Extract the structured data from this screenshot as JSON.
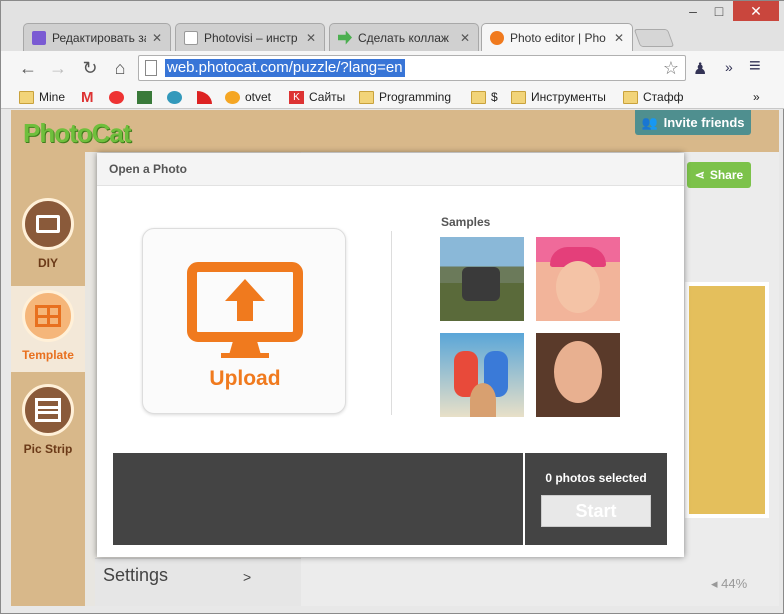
{
  "tabs": [
    {
      "title": "Редактировать за",
      "close": "✕"
    },
    {
      "title": "Photovisi – инстр",
      "close": "✕"
    },
    {
      "title": "Сделать коллаж",
      "close": "✕"
    },
    {
      "title": "Photo editor | Pho",
      "close": "✕"
    }
  ],
  "window": {
    "minimize": "–",
    "maximize": "□",
    "close": "✕"
  },
  "nav": {
    "back": "←",
    "forward": "→",
    "reload": "↻",
    "home": "⌂",
    "url": "web.photocat.com/puzzle/?lang=en",
    "star": "☆",
    "menu": "≡",
    "more": "»"
  },
  "bookmarks": [
    {
      "label": "Mine",
      "icon": "folder-icon"
    },
    {
      "label": "",
      "icon": "gmail-icon"
    },
    {
      "label": "",
      "icon": "bug-icon"
    },
    {
      "label": "",
      "icon": "app-icon"
    },
    {
      "label": "",
      "icon": "globe-icon"
    },
    {
      "label": "",
      "icon": "feed-icon"
    },
    {
      "label": "otvet",
      "icon": "otvet-icon"
    },
    {
      "label": "Сайты",
      "icon": "k-icon"
    },
    {
      "label": "Programming",
      "icon": "folder-icon"
    },
    {
      "label": "$",
      "icon": "folder-icon"
    },
    {
      "label": "Инструменты",
      "icon": "folder-icon"
    },
    {
      "label": "Стафф",
      "icon": "folder-icon"
    }
  ],
  "bookmarks_more": "»",
  "app": {
    "logo": "PhotoCat",
    "invite": "Invite friends",
    "share": "Share",
    "sidebar": [
      {
        "label": "DIY"
      },
      {
        "label": "Template"
      },
      {
        "label": "Pic Strip"
      }
    ],
    "settings": "Settings",
    "settings_arrow": ">",
    "zoom": "44%"
  },
  "modal": {
    "title": "Open a Photo",
    "upload": "Upload",
    "samples_title": "Samples",
    "selected": "0 photos selected",
    "start": "Start"
  },
  "colors": {
    "accent": "#f07a1e",
    "green": "#7cc24a",
    "teal": "#4f8f8f"
  }
}
